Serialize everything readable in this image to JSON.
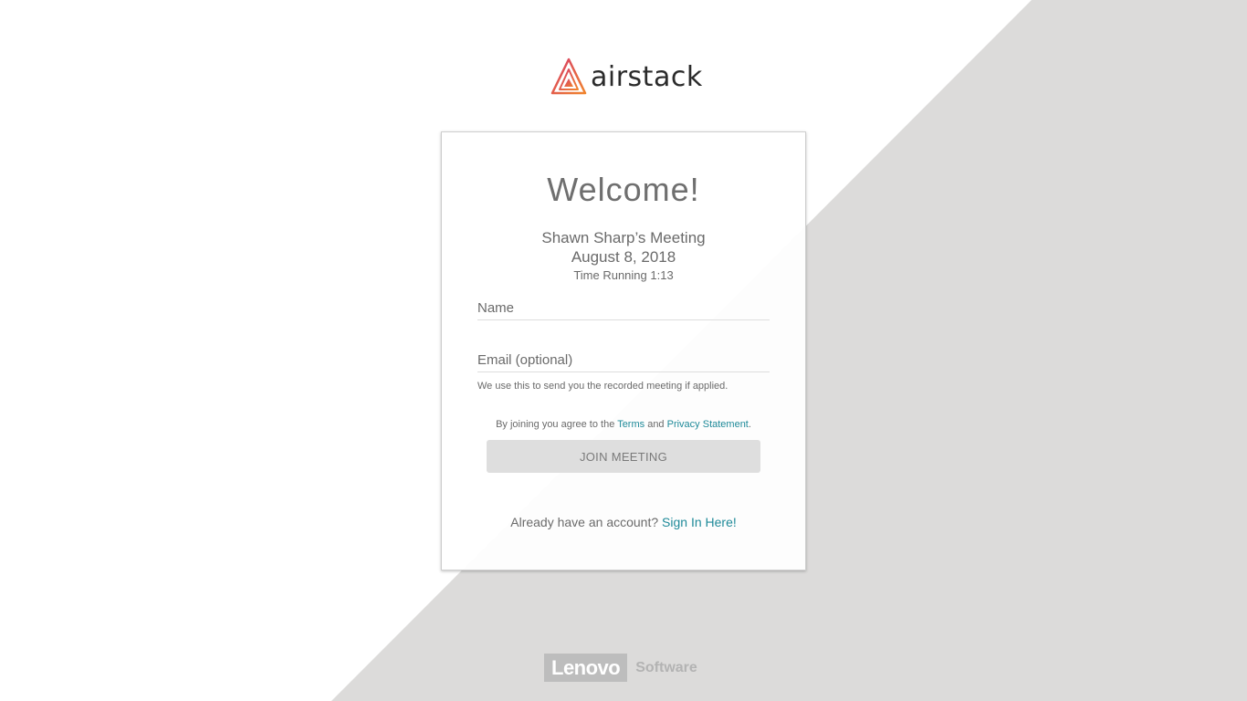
{
  "brand": {
    "name": "airstack",
    "accent_color": "#e8543a"
  },
  "card": {
    "title": "Welcome!",
    "meeting_name": "Shawn Sharp’s Meeting",
    "meeting_date": "August 8, 2018",
    "time_running": "Time Running 1:13"
  },
  "form": {
    "name_placeholder": "Name",
    "email_placeholder": "Email (optional)",
    "email_hint": "We use this to send you the recorded meeting if applied.",
    "terms_prefix": "By joining you agree to the ",
    "terms_link": "Terms",
    "terms_and": " and ",
    "privacy_link": "Privacy Statement",
    "terms_suffix": ".",
    "join_label": "JOIN MEETING"
  },
  "signin": {
    "prompt": "Already have an account? ",
    "link": "Sign In Here!"
  },
  "footer": {
    "company": "Lenovo",
    "division": "Software"
  },
  "colors": {
    "link": "#1f8a99",
    "background_grey": "#dcdbda",
    "button_bg": "#dedede"
  }
}
